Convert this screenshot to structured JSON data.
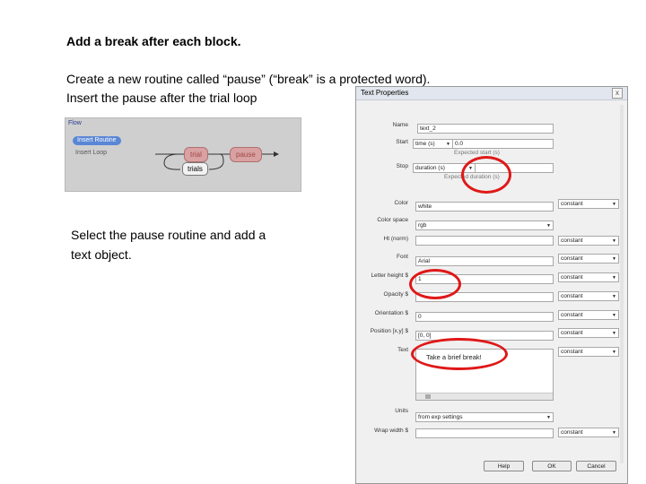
{
  "slide": {
    "title": "Add a break after each block.",
    "instruction1_line1": "Create a new routine called “pause” (“break” is a protected word).",
    "instruction1_line2": "Insert the pause after the trial loop",
    "instruction2_line1": "Select the pause routine and add a",
    "instruction2_line2": "text object."
  },
  "flow_panel": {
    "title": "Flow",
    "insert_routine": "Insert Routine",
    "insert_loop": "Insert Loop",
    "routines": [
      "trial",
      "pause"
    ],
    "loop_label": "trials"
  },
  "dialog": {
    "title": "Text Properties",
    "close_glyph": "x",
    "fields": {
      "name_label": "Name",
      "name_value": "text_2",
      "start_label": "Start",
      "start_unit": "time (s)",
      "start_value": "0.0",
      "start_hint": "Expected start (s)",
      "stop_label": "Stop",
      "stop_unit": "duration (s)",
      "stop_value": "",
      "stop_hint": "Expected duration (s)",
      "color_label": "Color",
      "color_value": "white",
      "color_mode": "constant",
      "colorspace_label": "Color space",
      "colorspace_value": "rgb",
      "height_label": "Ht (norm)",
      "height_value": "",
      "height_mode": "constant",
      "font_label": "Font",
      "font_value": "Arial",
      "font_mode": "constant",
      "letter_height_label": "Letter height $",
      "letter_height_value": "1",
      "letter_height_mode": "constant",
      "opacity_label": "Opacity $",
      "opacity_value": "",
      "opacity_mode": "constant",
      "orientation_label": "Orientation $",
      "orientation_value": "0",
      "orientation_mode": "constant",
      "position_label": "Position [x,y] $",
      "position_value": "[0, 0]",
      "position_mode": "constant",
      "text_label": "Text",
      "text_value": "Take a brief break!",
      "text_mode": "constant",
      "units_label": "Units",
      "units_value": "from exp settings",
      "wrap_label": "Wrap width $",
      "wrap_value": "",
      "wrap_mode": "constant"
    },
    "buttons": {
      "help": "Help",
      "ok": "OK",
      "cancel": "Cancel"
    }
  },
  "annotation_color": "#e01818"
}
